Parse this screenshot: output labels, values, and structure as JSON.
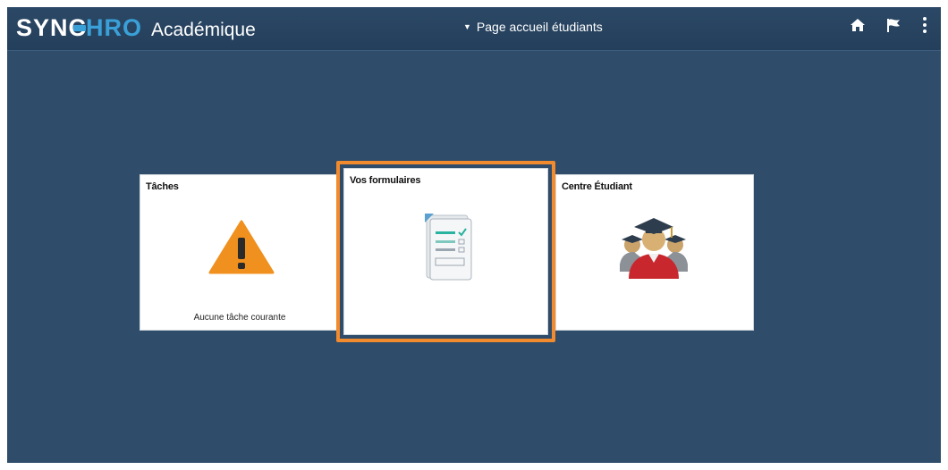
{
  "header": {
    "brand_syn": "SYN",
    "brand_c": "C",
    "brand_hro": "HRO",
    "brand_sub": "Académique",
    "page_nav_label": "Page accueil étudiants",
    "icons": [
      "home-icon",
      "flag-icon",
      "more-vert-icon"
    ]
  },
  "tiles": [
    {
      "title": "Tâches",
      "subtitle": "Aucune tâche courante",
      "icon": "warning-icon"
    },
    {
      "title": "Vos formulaires",
      "subtitle": "",
      "icon": "form-icon"
    },
    {
      "title": "Centre Étudiant",
      "subtitle": "",
      "icon": "graduate-icon"
    }
  ],
  "colors": {
    "background": "#2f4d6b",
    "brand_accent": "#3aa0d8",
    "highlight": "#f28a2e",
    "warning": "#f0901e"
  }
}
